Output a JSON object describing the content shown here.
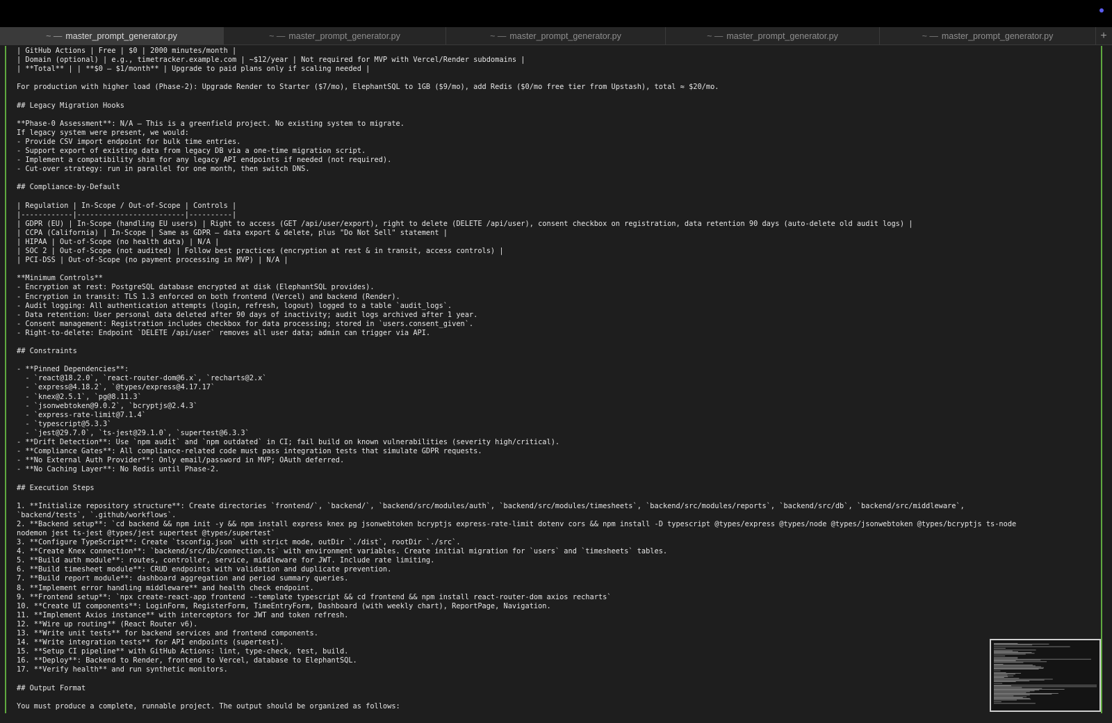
{
  "window": {
    "accent_dot_color": "#5b5cf0"
  },
  "tabs": [
    {
      "prefix": "~ —",
      "title": "master_prompt_generator.py",
      "active": true
    },
    {
      "prefix": "~ —",
      "title": "master_prompt_generator.py",
      "active": false
    },
    {
      "prefix": "~ —",
      "title": "master_prompt_generator.py",
      "active": false
    },
    {
      "prefix": "~ —",
      "title": "master_prompt_generator.py",
      "active": false
    },
    {
      "prefix": "~ —",
      "title": "master_prompt_generator.py",
      "active": false
    }
  ],
  "new_tab_label": "+",
  "terminal": {
    "gutter_color": "#5fa83f",
    "lines": [
      "| GitHub Actions | Free | $0 | 2000 minutes/month |",
      "| Domain (optional) | e.g., timetracker.example.com | ~$12/year | Not required for MVP with Vercel/Render subdomains |",
      "| **Total** | | **$0 – $1/month** | Upgrade to paid plans only if scaling needed |",
      "",
      "For production with higher load (Phase-2): Upgrade Render to Starter ($7/mo), ElephantSQL to 1GB ($9/mo), add Redis ($0/mo free tier from Upstash), total ≈ $20/mo.",
      "",
      "## Legacy Migration Hooks",
      "",
      "**Phase-0 Assessment**: N/A — This is a greenfield project. No existing system to migrate.",
      "If legacy system were present, we would:",
      "- Provide CSV import endpoint for bulk time entries.",
      "- Support export of existing data from legacy DB via a one-time migration script.",
      "- Implement a compatibility shim for any legacy API endpoints if needed (not required).",
      "- Cut-over strategy: run in parallel for one month, then switch DNS.",
      "",
      "## Compliance-by-Default",
      "",
      "| Regulation | In-Scope / Out-of-Scope | Controls |",
      "|------------|-------------------------|----------|",
      "| GDPR (EU) | In-Scope (handling EU users) | Right to access (GET /api/user/export), right to delete (DELETE /api/user), consent checkbox on registration, data retention 90 days (auto-delete old audit logs) |",
      "| CCPA (California) | In-Scope | Same as GDPR – data export & delete, plus \"Do Not Sell\" statement |",
      "| HIPAA | Out-of-Scope (no health data) | N/A |",
      "| SOC 2 | Out-of-Scope (not audited) | Follow best practices (encryption at rest & in transit, access controls) |",
      "| PCI-DSS | Out-of-Scope (no payment processing in MVP) | N/A |",
      "",
      "**Minimum Controls**",
      "- Encryption at rest: PostgreSQL database encrypted at disk (ElephantSQL provides).",
      "- Encryption in transit: TLS 1.3 enforced on both frontend (Vercel) and backend (Render).",
      "- Audit logging: All authentication attempts (login, refresh, logout) logged to a table `audit_logs`.",
      "- Data retention: User personal data deleted after 90 days of inactivity; audit logs archived after 1 year.",
      "- Consent management: Registration includes checkbox for data processing; stored in `users.consent_given`.",
      "- Right-to-delete: Endpoint `DELETE /api/user` removes all user data; admin can trigger via API.",
      "",
      "## Constraints",
      "",
      "- **Pinned Dependencies**:",
      "  - `react@18.2.0`, `react-router-dom@6.x`, `recharts@2.x`",
      "  - `express@4.18.2`, `@types/express@4.17.17`",
      "  - `knex@2.5.1`, `pg@8.11.3`",
      "  - `jsonwebtoken@9.0.2`, `bcryptjs@2.4.3`",
      "  - `express-rate-limit@7.1.4`",
      "  - `typescript@5.3.3`",
      "  - `jest@29.7.0`, `ts-jest@29.1.0`, `supertest@6.3.3`",
      "- **Drift Detection**: Use `npm audit` and `npm outdated` in CI; fail build on known vulnerabilities (severity high/critical).",
      "- **Compliance Gates**: All compliance-related code must pass integration tests that simulate GDPR requests.",
      "- **No External Auth Provider**: Only email/password in MVP; OAuth deferred.",
      "- **No Caching Layer**: No Redis until Phase-2.",
      "",
      "## Execution Steps",
      "",
      "1. **Initialize repository structure**: Create directories `frontend/`, `backend/`, `backend/src/modules/auth`, `backend/src/modules/timesheets`, `backend/src/modules/reports`, `backend/src/db`, `backend/src/middleware`,",
      "`backend/tests`, `.github/workflows`.",
      "2. **Backend setup**: `cd backend && npm init -y && npm install express knex pg jsonwebtoken bcryptjs express-rate-limit dotenv cors && npm install -D typescript @types/express @types/node @types/jsonwebtoken @types/bcryptjs ts-node",
      "nodemon jest ts-jest @types/jest supertest @types/supertest`",
      "3. **Configure TypeScript**: Create `tsconfig.json` with strict mode, outDir `./dist`, rootDir `./src`.",
      "4. **Create Knex connection**: `backend/src/db/connection.ts` with environment variables. Create initial migration for `users` and `timesheets` tables.",
      "5. **Build auth module**: routes, controller, service, middleware for JWT. Include rate limiting.",
      "6. **Build timesheet module**: CRUD endpoints with validation and duplicate prevention.",
      "7. **Build report module**: dashboard aggregation and period summary queries.",
      "8. **Implement error handling middleware** and health check endpoint.",
      "9. **Frontend setup**: `npx create-react-app frontend --template typescript && cd frontend && npm install react-router-dom axios recharts`",
      "10. **Create UI components**: LoginForm, RegisterForm, TimeEntryForm, Dashboard (with weekly chart), ReportPage, Navigation.",
      "11. **Implement Axios instance** with interceptors for JWT and token refresh.",
      "12. **Wire up routing** (React Router v6).",
      "13. **Write unit tests** for backend services and frontend components.",
      "14. **Write integration tests** for API endpoints (supertest).",
      "15. **Setup CI pipeline** with GitHub Actions: lint, type-check, test, build.",
      "16. **Deploy**: Backend to Render, frontend to Vercel, database to ElephantSQL.",
      "17. **Verify health** and run synthetic monitors.",
      "",
      "## Output Format",
      "",
      "You must produce a complete, runnable project. The output should be organized as follows:"
    ]
  }
}
